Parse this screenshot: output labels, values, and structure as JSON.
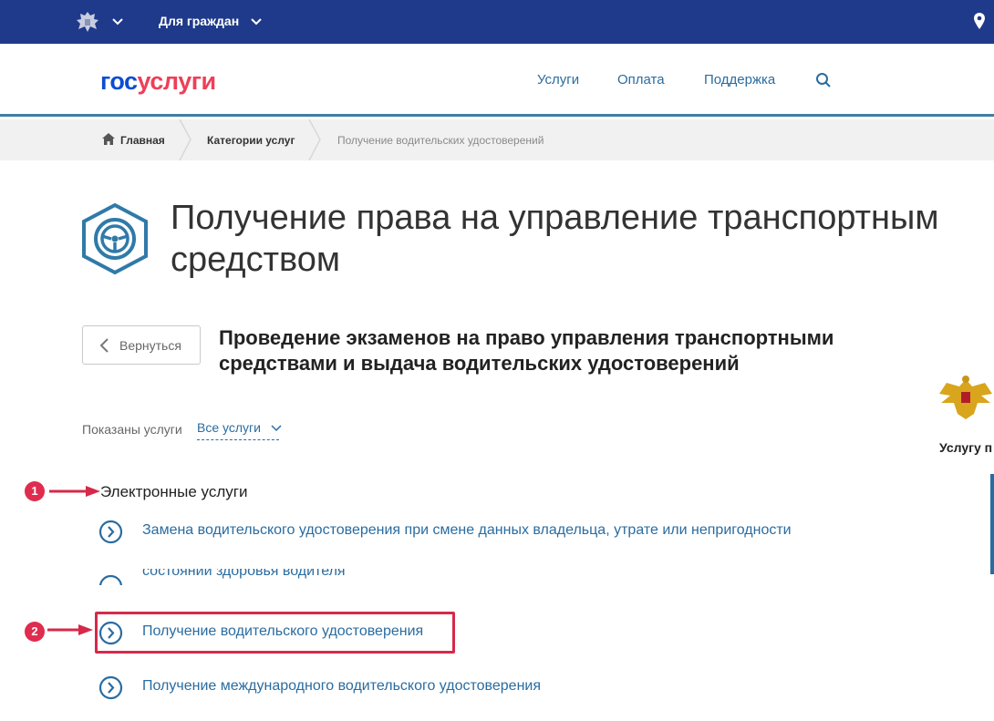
{
  "topbar": {
    "audience_label": "Для граждан",
    "emblem_icon": "coat-of-arms-icon",
    "location_icon": "map-pin-icon",
    "background": "#1f3a8a"
  },
  "header": {
    "logo_part1": "гос",
    "logo_part2": "услуги",
    "logo_colors": {
      "part1": "#0d4cd3",
      "part2": "#ee3f58"
    },
    "nav": [
      "Услуги",
      "Оплата",
      "Поддержка"
    ],
    "search_icon": "search-icon"
  },
  "breadcrumb": {
    "home": "Главная",
    "category": "Категории услуг",
    "current": "Получение водительских удостоверений"
  },
  "page": {
    "title_line1": "Получение права на управление транспортным",
    "title_line2": "средством",
    "category_icon": "steering-wheel-icon",
    "back_label": "Вернуться",
    "subtitle_line1": "Проведение экзаменов на право управления транспортными",
    "subtitle_line2": "средствами и выдача водительских удостоверений",
    "filter_label": "Показаны услуги",
    "filter_value": "Все услуги"
  },
  "sidebar": {
    "org_emblem": "eagle-emblem-icon",
    "org_text": "Услугу п"
  },
  "annotations": {
    "badge1": "1",
    "badge2": "2",
    "accent": "#e02c4e"
  },
  "services": {
    "section_title": "Электронные услуги",
    "items": [
      "Замена водительского удостоверения при смене данных владельца, утрате или непригодности",
      "состоянии здоровья водителя",
      "Получение водительского удостоверения",
      "Получение международного водительского удостоверения"
    ]
  }
}
